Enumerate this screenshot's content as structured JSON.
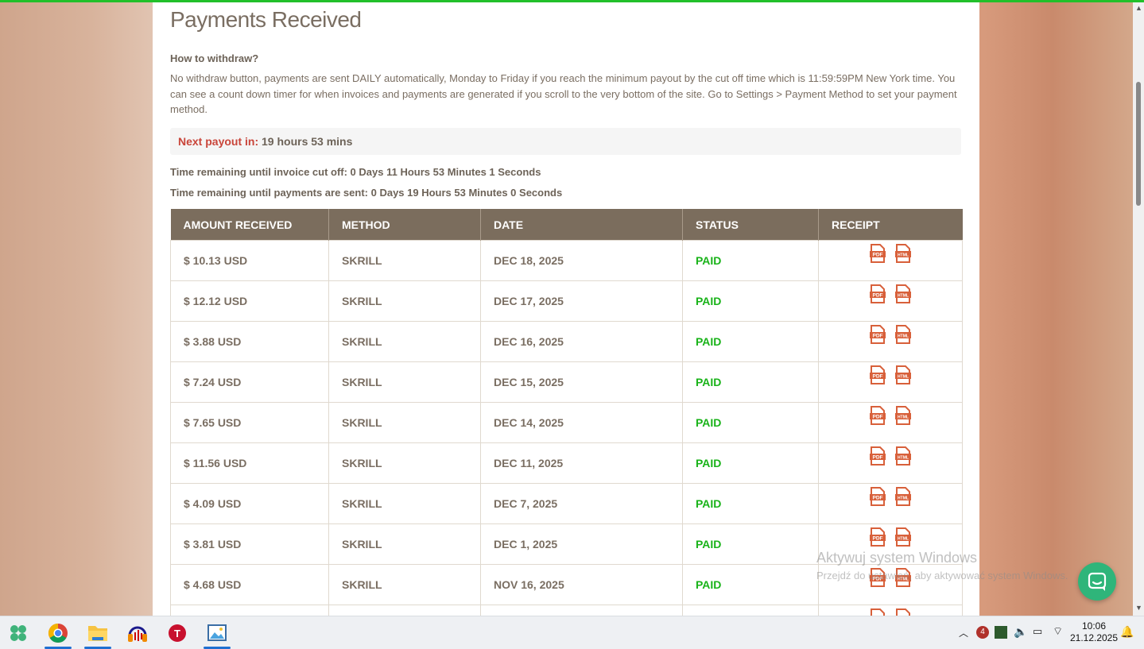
{
  "page": {
    "title": "Payments Received",
    "howto_heading": "How to withdraw?",
    "howto_text": "No withdraw button, payments are sent DAILY automatically, Monday to Friday if you reach the minimum payout by the cut off time which is 11:59:59PM New York time. You can see a count down timer for when invoices and payments are generated if you scroll to the very bottom of the site. Go to Settings > Payment Method to set your payment method.",
    "next_payout_label": "Next payout in:",
    "next_payout_value": "19 hours 53 mins",
    "invoice_cutoff": "Time remaining until invoice cut off: 0 Days 11 Hours 53 Minutes 1 Seconds",
    "payments_sent": "Time remaining until payments are sent: 0 Days 19 Hours 53 Minutes 0 Seconds"
  },
  "table": {
    "headers": [
      "AMOUNT RECEIVED",
      "METHOD",
      "DATE",
      "STATUS",
      "RECEIPT"
    ],
    "rows": [
      {
        "amount": "$ 10.13 USD",
        "method": "SKRILL",
        "date": "DEC 18, 2025",
        "status": "PAID"
      },
      {
        "amount": "$ 12.12 USD",
        "method": "SKRILL",
        "date": "DEC 17, 2025",
        "status": "PAID"
      },
      {
        "amount": "$ 3.88 USD",
        "method": "SKRILL",
        "date": "DEC 16, 2025",
        "status": "PAID"
      },
      {
        "amount": "$ 7.24 USD",
        "method": "SKRILL",
        "date": "DEC 15, 2025",
        "status": "PAID"
      },
      {
        "amount": "$ 7.65 USD",
        "method": "SKRILL",
        "date": "DEC 14, 2025",
        "status": "PAID"
      },
      {
        "amount": "$ 11.56 USD",
        "method": "SKRILL",
        "date": "DEC 11, 2025",
        "status": "PAID"
      },
      {
        "amount": "$ 4.09 USD",
        "method": "SKRILL",
        "date": "DEC 7, 2025",
        "status": "PAID"
      },
      {
        "amount": "$ 3.81 USD",
        "method": "SKRILL",
        "date": "DEC 1, 2025",
        "status": "PAID"
      },
      {
        "amount": "$ 4.68 USD",
        "method": "SKRILL",
        "date": "NOV 16, 2025",
        "status": "PAID"
      },
      {
        "amount": "",
        "method": "",
        "date": "",
        "status": ""
      }
    ],
    "pdf_icon_label": "PDF",
    "html_icon_label": "HTML"
  },
  "watermark": {
    "line1": "Aktywuj system Windows",
    "line2": "Przejdź do ustawień, aby aktywować system Windows."
  },
  "taskbar": {
    "apps": [
      "start-icon",
      "chrome-icon",
      "file-explorer-icon",
      "audacity-icon",
      "t-app-icon",
      "photos-icon"
    ],
    "tray_badge": "4",
    "time": "10:06",
    "date": "21.12.2025"
  },
  "colors": {
    "header_bg": "#7b6d5d",
    "paid": "#19b319",
    "payout_label": "#c9453a",
    "icon": "#d8603a"
  }
}
